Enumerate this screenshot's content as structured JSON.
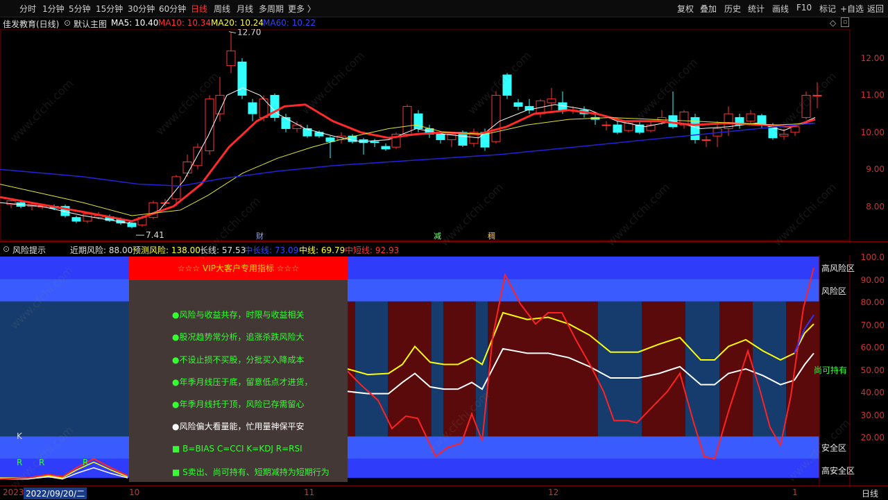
{
  "toolbar": {
    "left_items": [
      "分时",
      "1分钟",
      "5分钟",
      "15分钟",
      "30分钟",
      "60分钟",
      "日线",
      "周线",
      "月线",
      "多周期",
      "更多 〉"
    ],
    "active_index": 6,
    "right_items": [
      "复权",
      "叠加",
      "历史",
      "统计",
      "画线",
      "F10",
      "标记",
      "+自选",
      "返回"
    ]
  },
  "main_header": {
    "stock": "佳发教育(日线)",
    "template": "默认主图",
    "ma5": "MA5: 10.40",
    "ma10": "MA10: 10.34",
    "ma20": "MA20: 10.24",
    "ma60": "MA60: 10.22",
    "colors": {
      "ma5": "#ffffff",
      "ma10": "#ff3333",
      "ma20": "#ffff33",
      "ma60": "#3333ff"
    }
  },
  "price_axis": [
    "12.00",
    "11.00",
    "10.00",
    "9.00",
    "8.00"
  ],
  "annotations": {
    "high": "12.70",
    "low": "7.41",
    "marker_cai": "财",
    "marker_jian": "减",
    "marker_chou": "稠"
  },
  "risk_header": {
    "title": "风险提示",
    "near": "近期风险: 88.00",
    "predict": "预测风险: 138.00",
    "long": "长线: 57.53",
    "midlong": "中长线: 73.09",
    "mid": "中线: 69.79",
    "short": "中短线: 92.93"
  },
  "risk_axis": [
    "100.0",
    "90.00",
    "80.00",
    "70.00",
    "60.00",
    "50.00",
    "40.00",
    "30.00",
    "20.00"
  ],
  "zones": {
    "high_risk": "高风险区",
    "risk": "风险区",
    "hold": "尚可持有",
    "safe": "安全区",
    "very_safe": "高安全区"
  },
  "promo": {
    "title": "☆☆☆  VIP大客户专用指标  ☆☆☆",
    "lines": [
      "●风险与收益共存，时限与收益相关",
      "●股况趋势常分析，追涨杀跌风险大",
      "●不设止损不买股，分批买入降成本",
      "●年季月线压于底，留意低点才进货，",
      "●年季月线托于顶，风险已存需留心",
      "●风险偏大看量能，忙用量神保平安",
      "■ B=BIAS    C=CCI    K=KDJ    R=RSI",
      "■ S卖出、尚可持有、短期减持为短期行为"
    ]
  },
  "signals": {
    "k": "K",
    "r": "R"
  },
  "bottom": {
    "year": "2023",
    "date": "2022/09/20/二",
    "ticks": [
      "10",
      "11",
      "12",
      "1"
    ],
    "right": "日线"
  },
  "watermark": "www.cfchi.com"
}
